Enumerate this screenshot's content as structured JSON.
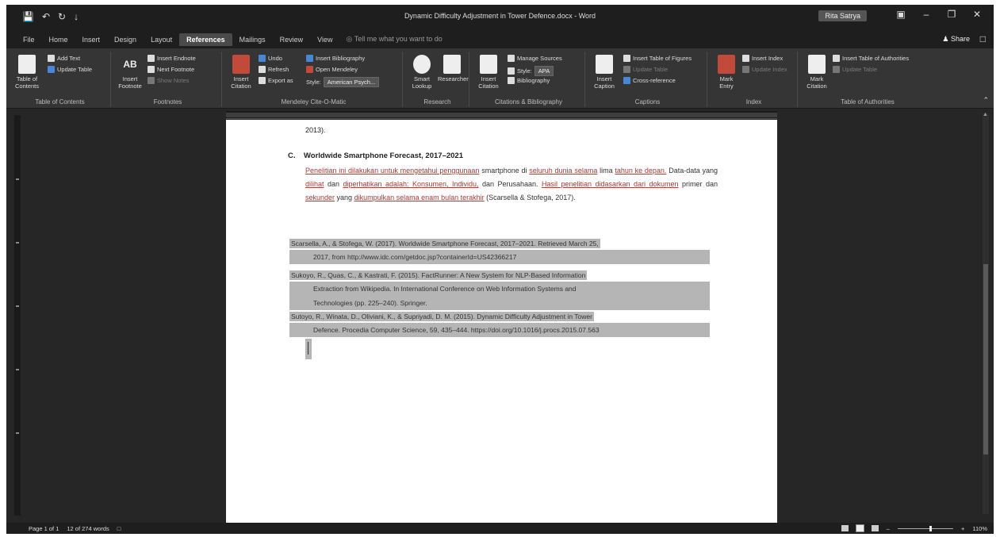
{
  "window": {
    "title": "Dynamic Difficulty Adjustment in Tower Defence.docx - Word",
    "user": "Rita Satrya",
    "quick_access": [
      "save-icon",
      "undo-icon",
      "redo-icon",
      "customize-icon"
    ]
  },
  "tabs": {
    "items": [
      "File",
      "Home",
      "Insert",
      "Design",
      "Layout",
      "References",
      "Mailings",
      "Review",
      "View"
    ],
    "active": "References",
    "tell_me": "Tell me what you want to do",
    "share": "Share"
  },
  "ribbon": {
    "toc": {
      "big": "Table of Contents",
      "add_text": "Add Text",
      "update_table": "Update Table",
      "label": "Table of Contents"
    },
    "footnotes": {
      "insert_footnote": "Insert Footnote",
      "insert_endnote": "Insert Endnote",
      "next_footnote": "Next Footnote",
      "show_notes": "Show Notes",
      "label": "Footnotes"
    },
    "mendeley": {
      "insert_citation": "Insert Citation",
      "undo": "Undo",
      "refresh": "Refresh",
      "export_as": "Export as",
      "insert_bibliography": "Insert Bibliography",
      "open_mendeley": "Open Mendeley",
      "style_label": "Style:",
      "style_value": "American Psych...",
      "label": "Mendeley Cite-O-Matic"
    },
    "research": {
      "smart_lookup": "Smart Lookup",
      "researcher": "Researcher",
      "label": "Research"
    },
    "citations": {
      "insert_citation": "Insert Citation",
      "manage_sources": "Manage Sources",
      "style_label": "Style:",
      "style_value": "APA",
      "bibliography": "Bibliography",
      "label": "Citations & Bibliography"
    },
    "captions": {
      "insert_caption": "Insert Caption",
      "insert_table_of_figures": "Insert Table of Figures",
      "update_table": "Update Table",
      "cross_reference": "Cross-reference",
      "label": "Captions"
    },
    "index": {
      "mark_entry": "Mark Entry",
      "insert_index": "Insert Index",
      "update_index": "Update Index",
      "label": "Index"
    },
    "authorities": {
      "mark_citation": "Mark Citation",
      "insert_table_of_authorities": "Insert Table of Authorities",
      "update_table": "Update Table",
      "label": "Table of Authorities"
    }
  },
  "document": {
    "continuation": "2013).",
    "section_letter": "C.",
    "section_title": "Worldwide Smartphone Forecast, 2017–2021",
    "paragraph": {
      "s1": "Penelitian ini dilakukan untuk mengetahui penggunaan",
      "s2": " smartphone di ",
      "s3": "seluruh dunia selama",
      "s4": " lima ",
      "s5": "tahun ke depan.",
      "s6": " Data-data yang ",
      "s7": "dilihat",
      "s8": " dan ",
      "s9": "diperhatikan adalah: Konsumen, Individu,",
      "s10": " dan Perusahaan. ",
      "s11": "Hasil penelitian didasarkan dari dokumen",
      "s12": " primer dan ",
      "s13": "sekunder",
      "s14": " yang ",
      "s15": "dikumpulkan selama enam bulan terakhir",
      "s16": " (Scarsella & Stofega, 2017)."
    },
    "references": [
      {
        "line1": "Scarsella, A., & Stofega, W. (2017). Worldwide Smartphone Forecast, 2017–2021. Retrieved March 25,",
        "line2": "2017, from http://www.idc.com/getdoc.jsp?containerId=US42366217"
      },
      {
        "line1": "Sukoyo, R., Quas, C., & Kastrati, F. (2015). FactRunner: A New System for NLP-Based Information",
        "line2": "Extraction from Wikipedia. In International Conference on Web Information Systems and",
        "line3": "Technologies (pp. 225–240). Springer."
      },
      {
        "line1": "Sutoyo, R., Winata, D., Oliviani, K., & Supriyadi, D. M. (2015). Dynamic Difficulty Adjustment in Tower",
        "line2": "Defence. Procedia Computer Science, 59, 435–444. https://doi.org/10.1016/j.procs.2015.07.563"
      }
    ]
  },
  "status": {
    "page": "Page 1 of 1",
    "words": "12 of 274 words",
    "zoom": "110%"
  }
}
